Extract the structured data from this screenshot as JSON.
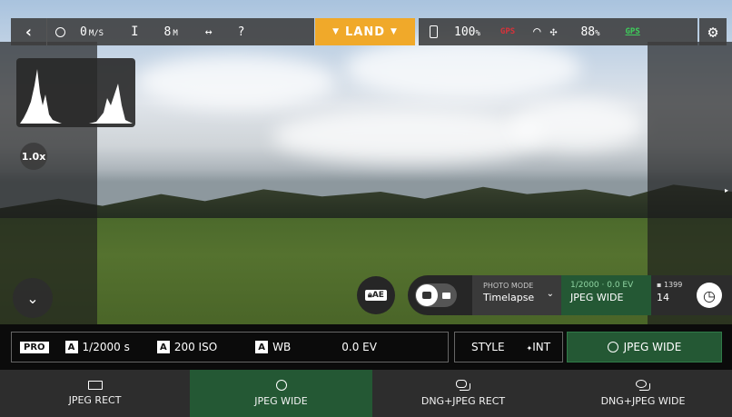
{
  "topbar": {
    "speed": "0",
    "speed_unit": "M/S",
    "altitude": "8",
    "altitude_unit": "M",
    "distance": "?",
    "land_label": "LAND",
    "phone_battery": "100",
    "phone_battery_unit": "%",
    "drone_gps_label": "GPS",
    "drone_battery": "88",
    "drone_battery_unit": "%",
    "gps_label": "GPS"
  },
  "view": {
    "zoom": "1.0x"
  },
  "capture": {
    "ae_lock_label": "AE",
    "photo_mode_label": "PHOTO MODE",
    "photo_mode_value": "Timelapse",
    "exposure_summary": "1/2000 · 0.0 EV",
    "format_value": "JPEG WIDE",
    "storage_count": "1399",
    "interval_value": "14"
  },
  "settings": {
    "pro_label": "PRO",
    "shutter_label": "1/2000 s",
    "iso_label": "200 ISO",
    "wb_label": "WB",
    "ev_label": "0.0 EV",
    "style_label": "STYLE",
    "int_label": "INT",
    "format_button_label": "JPEG WIDE",
    "auto_letter": "A"
  },
  "formats": [
    {
      "label": "JPEG RECT",
      "icon": "rect-icon",
      "active": false
    },
    {
      "label": "JPEG WIDE",
      "icon": "circle-icon",
      "active": true
    },
    {
      "label": "DNG+JPEG RECT",
      "icon": "dual-rect-icon",
      "active": false
    },
    {
      "label": "DNG+JPEG WIDE",
      "icon": "dual-circle-icon",
      "active": false
    }
  ],
  "colors": {
    "accent_orange": "#f0a92a",
    "accent_green": "#245834",
    "gps_green": "#3ecf5b",
    "gps_red": "#d8323a"
  }
}
